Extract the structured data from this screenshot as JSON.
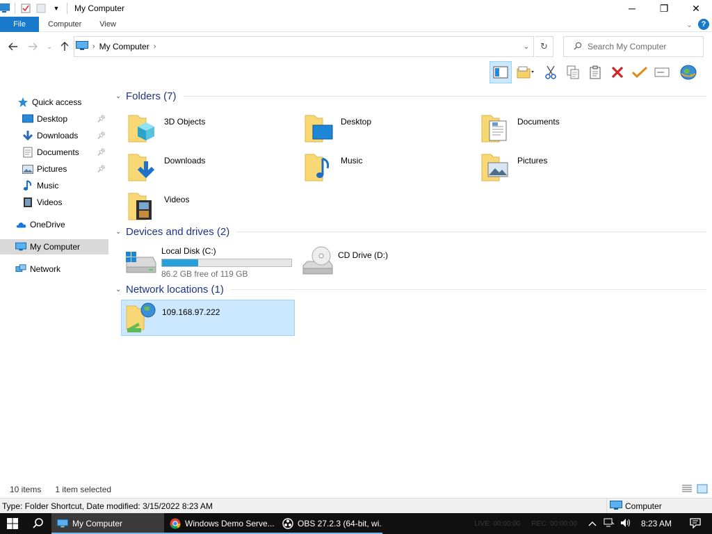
{
  "window": {
    "title": "My Computer",
    "minimize": "─",
    "maximize": "❐",
    "close": "✕"
  },
  "ribbon": {
    "tabs": [
      "File",
      "Computer",
      "View"
    ]
  },
  "address": {
    "location": "My Computer",
    "search_placeholder": "Search My Computer"
  },
  "sidebar": {
    "items": [
      {
        "label": "Quick access",
        "icon": "star-icon"
      },
      {
        "label": "Desktop",
        "icon": "desktop-icon",
        "pinned": true
      },
      {
        "label": "Downloads",
        "icon": "download-icon",
        "pinned": true
      },
      {
        "label": "Documents",
        "icon": "document-icon",
        "pinned": true
      },
      {
        "label": "Pictures",
        "icon": "picture-icon",
        "pinned": true
      },
      {
        "label": "Music",
        "icon": "music-icon"
      },
      {
        "label": "Videos",
        "icon": "video-icon"
      },
      {
        "label": "OneDrive",
        "icon": "cloud-icon"
      },
      {
        "label": "My Computer",
        "icon": "computer-icon",
        "selected": true
      },
      {
        "label": "Network",
        "icon": "network-icon"
      }
    ]
  },
  "groups": {
    "folders": "Folders (7)",
    "devices": "Devices and drives (2)",
    "network": "Network locations (1)"
  },
  "folders": [
    {
      "label": "3D Objects"
    },
    {
      "label": "Desktop"
    },
    {
      "label": "Documents"
    },
    {
      "label": "Downloads"
    },
    {
      "label": "Music"
    },
    {
      "label": "Pictures"
    },
    {
      "label": "Videos"
    }
  ],
  "drives": [
    {
      "label": "Local Disk (C:)",
      "free": "86.2 GB free of 119 GB",
      "used_fraction": 0.28
    },
    {
      "label": "CD Drive (D:)"
    }
  ],
  "network_location": {
    "label": "109.168.97.222"
  },
  "status": {
    "items": "10 items",
    "selected": "1 item selected"
  },
  "details": {
    "text": "Type: Folder Shortcut, Date modified: 3/15/2022 8:23 AM",
    "right": "Computer"
  },
  "taskbar": {
    "tasks": [
      {
        "label": "My Computer",
        "active": true
      },
      {
        "label": "Windows Demo Serve..."
      },
      {
        "label": "OBS 27.2.3 (64-bit, wi..."
      }
    ],
    "obs_live": "LIVE: 00:00:00",
    "obs_rec": "REC: 00:00:00",
    "time": "8:23 AM"
  },
  "colors": {
    "accent": "#1979ca",
    "selection": "#cce8ff",
    "group_title": "#1e3287",
    "drive_fill": "#26a0da"
  }
}
